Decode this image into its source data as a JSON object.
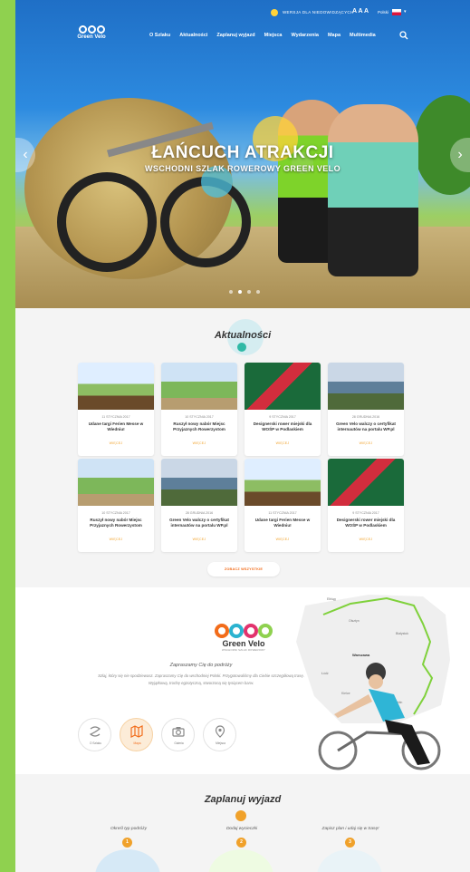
{
  "header": {
    "high_contrast": "WERSJA DLA NIEDOWIDZĄCYCH",
    "font_sizes": "A A A",
    "language": "Polski",
    "logo_text": "Green Velo",
    "nav": [
      "O Szlaku",
      "Aktualności",
      "Zaplanuj wyjazd",
      "Miejsca",
      "Wydarzenia",
      "Mapa",
      "Multimedia"
    ]
  },
  "hero": {
    "title": "ŁAŃCUCH ATRAKCJI",
    "subtitle": "WSCHODNI SZLAK ROWEROWY GREEN VELO"
  },
  "news": {
    "title": "Aktualności",
    "more_label": "WIĘCEJ",
    "all_button": "ZOBACZ WSZYSTKIE",
    "items": [
      {
        "date": "11 STYCZNIA 2017",
        "title": "Udane targi Ferien Messe w Wiedniu!"
      },
      {
        "date": "10 STYCZNIA 2017",
        "title": "Ruszył nowy nabór Miejsc Przyjaznych Rowerzystom"
      },
      {
        "date": "9 STYCZNIA 2017",
        "title": "Designerski rower miejski dla WOŚP w Podlaskiem"
      },
      {
        "date": "28 GRUDNIA 2016",
        "title": "Green Velo walczy o certyfikat internautów na portalu WP.pl"
      },
      {
        "date": "10 STYCZNIA 2017",
        "title": "Ruszył nowy nabór Miejsc Przyjaznych Rowerzystom"
      },
      {
        "date": "28 GRUDNIA 2016",
        "title": "Green Velo walczy o certyfikat internautów na portalu WP.pl"
      },
      {
        "date": "11 STYCZNIA 2017",
        "title": "Udane targi Ferien Messe w Wiedniu!"
      },
      {
        "date": "9 STYCZNIA 2017",
        "title": "Designerski rower miejski dla WOŚP w Podlaskiem"
      }
    ]
  },
  "invite": {
    "logo_text": "Green Velo",
    "logo_sub": "WSCHODNI SZLAK ROWEROWY",
    "title": "Zapraszamy Cię do podróży",
    "text": "Szlaj, który się nie spodziewasz. Zapraszamy Cię do wschodniej Polski. Przygotowaliśmy dla Ciebie szczegółową trasę. Wyjątkową, trochę egzotyczną, stworzoną się tysiącem barw.",
    "buttons": [
      "O Szlaku",
      "Mapa",
      "Galeria",
      "Miejsca"
    ]
  },
  "map": {
    "labels": [
      "Elbląg",
      "Olsztyn",
      "Białystok",
      "Warszawa",
      "Lublin",
      "Kielce",
      "Łódź"
    ]
  },
  "plan": {
    "title": "Zaplanuj wyjazd",
    "steps": [
      {
        "num": "1",
        "label": "Określ typ podróży"
      },
      {
        "num": "2",
        "label": "Dodaj wycieczki"
      },
      {
        "num": "3",
        "label": "Zapisz plan i udaj się w trasę!"
      }
    ]
  },
  "colors": {
    "accent_green": "#8fd14f",
    "accent_orange": "#f0a12a",
    "accent_teal": "#30b9a6"
  }
}
